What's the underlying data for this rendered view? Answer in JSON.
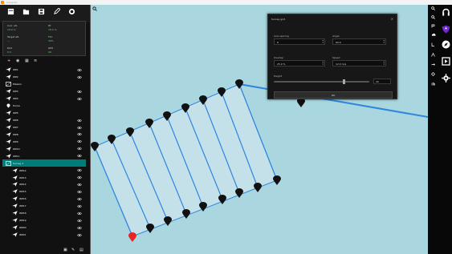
{
  "window": {
    "title": "ardupilot"
  },
  "main_toolbar": {
    "items": [
      {
        "name": "new-file-icon",
        "label": ""
      },
      {
        "name": "open-folder-icon",
        "label": ""
      },
      {
        "name": "save-icon",
        "label": ""
      },
      {
        "name": "pen-tool-icon",
        "label": ""
      },
      {
        "name": "target-tool-icon",
        "label": ""
      }
    ]
  },
  "info_panel": {
    "rows": [
      {
        "label": "Curr. alt.",
        "value": "10.0 m",
        "label2": "Ht",
        "value2": "18.2 m"
      },
      {
        "label": "Target alt.",
        "value": "---",
        "label2": "Thr.",
        "value2": "30%"
      },
      {
        "label": "Dist",
        "value": "0.0",
        "label2": "GPS",
        "value2": "OK"
      }
    ]
  },
  "layer_toolbar": {
    "items": [
      "plus",
      "eye",
      "grid",
      "list"
    ]
  },
  "layers": {
    "items": [
      {
        "label": "WP1",
        "type": "plane",
        "eye": true
      },
      {
        "label": "WP2",
        "type": "plane",
        "eye": true
      },
      {
        "label": "Mission",
        "type": "polygon",
        "eye": false
      },
      {
        "label": "WP3",
        "type": "plane",
        "eye": true
      },
      {
        "label": "WP4",
        "type": "plane",
        "eye": true
      },
      {
        "label": "Home",
        "type": "pin",
        "eye": false
      },
      {
        "label": "WP5",
        "type": "plane",
        "eye": false
      },
      {
        "label": "WP6",
        "type": "plane",
        "eye": true
      },
      {
        "label": "WP7",
        "type": "plane",
        "eye": true
      },
      {
        "label": "WP8",
        "type": "plane",
        "eye": true
      },
      {
        "label": "WP9",
        "type": "plane",
        "eye": true
      },
      {
        "label": "WP10",
        "type": "plane",
        "eye": true
      },
      {
        "label": "WP11",
        "type": "plane",
        "eye": true
      },
      {
        "label": "Survey 1",
        "type": "polygon",
        "eye": false,
        "selected": true
      },
      {
        "label": "WP12",
        "type": "plane",
        "eye": true,
        "nested": true
      },
      {
        "label": "WP13",
        "type": "plane",
        "eye": true,
        "nested": true
      },
      {
        "label": "WP14",
        "type": "plane",
        "eye": true,
        "nested": true
      },
      {
        "label": "WP15",
        "type": "plane",
        "eye": true,
        "nested": true
      },
      {
        "label": "WP16",
        "type": "plane",
        "eye": true,
        "nested": true
      },
      {
        "label": "WP17",
        "type": "plane",
        "eye": true,
        "nested": true
      },
      {
        "label": "WP18",
        "type": "plane",
        "eye": true,
        "nested": true
      },
      {
        "label": "WP19",
        "type": "plane",
        "eye": true,
        "nested": true
      },
      {
        "label": "WP20",
        "type": "plane",
        "eye": true,
        "nested": true
      },
      {
        "label": "WP21",
        "type": "plane",
        "eye": true,
        "nested": true
      }
    ]
  },
  "dialog": {
    "title": "Survey grid",
    "fields": [
      {
        "label": "Line spacing",
        "value": "6"
      },
      {
        "label": "Angle",
        "value": "60.0"
      },
      {
        "label": "Overlap",
        "value": "25.0 %"
      },
      {
        "label": "Speed",
        "value": "12.0 m/s"
      }
    ],
    "slider_label": "Height",
    "slider_value_label": "40",
    "slider_level": 0.72,
    "ok_label": "OK"
  },
  "right_toolbar": {
    "items": [
      {
        "name": "search-icon"
      },
      {
        "name": "headset-icon"
      },
      {
        "name": "zoom-in-icon"
      },
      {
        "name": "shield-icon"
      },
      {
        "name": "cloud-icon"
      },
      {
        "name": "compass-icon"
      },
      {
        "name": "ruler-icon"
      },
      {
        "name": "play-video-icon"
      },
      {
        "name": "polygon-tool-icon"
      },
      {
        "name": "gear-icon"
      },
      {
        "name": "route-icon"
      },
      {
        "name": "flag-icon"
      },
      {
        "name": "arrows-icon"
      }
    ]
  },
  "colors": {
    "map": "#a9d6df",
    "route": "#2e86de",
    "marker": "#111111",
    "home_marker": "#e62525",
    "selected_layer": "#007d79",
    "accent": "#ffffff"
  }
}
